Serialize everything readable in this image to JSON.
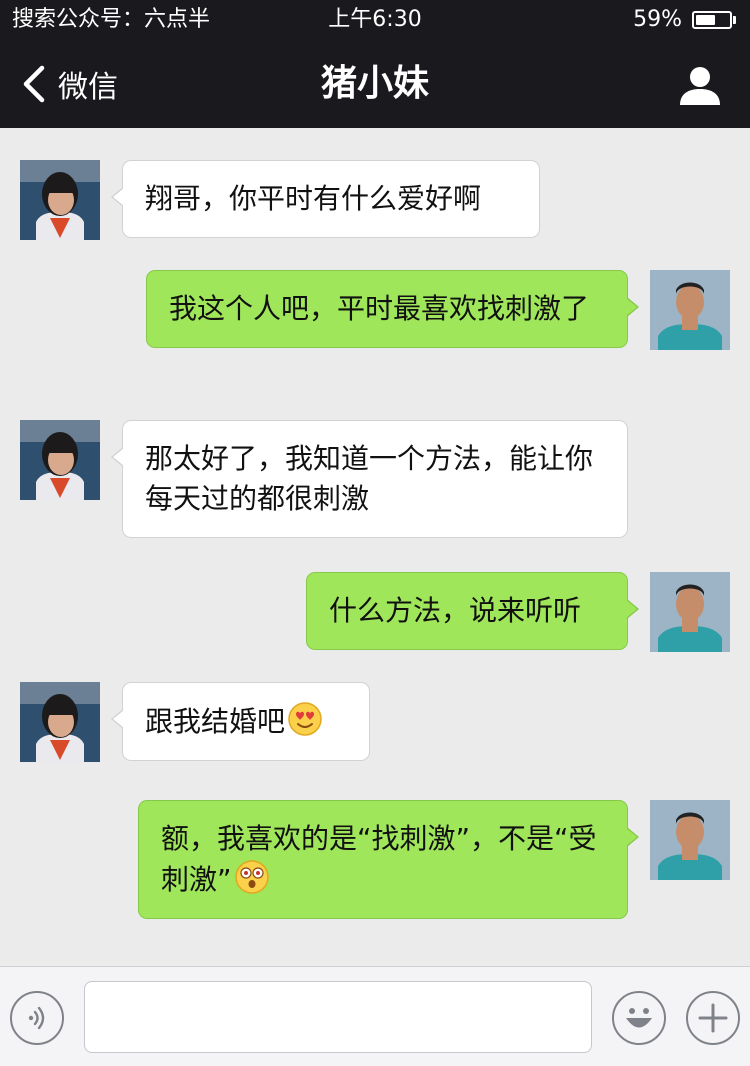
{
  "status_bar": {
    "carrier": "搜索公众号：六点半",
    "time": "上午6:30",
    "battery_percent": "59%",
    "battery_level": 0.59
  },
  "nav": {
    "back_label": "微信",
    "title": "猪小妹",
    "profile_icon": "person-icon"
  },
  "messages": [
    {
      "side": "left",
      "text": "翔哥，你平时有什么爱好啊"
    },
    {
      "side": "right",
      "text": "我这个人吧，平时最喜欢找刺激了"
    },
    {
      "side": "left",
      "text": "那太好了，我知道一个方法，能让你每天过的都很刺激"
    },
    {
      "side": "right",
      "text": "什么方法，说来听听"
    },
    {
      "side": "left",
      "text": "跟我结婚吧",
      "emoji": "heart-eyes-emoji"
    },
    {
      "side": "right",
      "text": "额，我喜欢的是“找刺激”，不是“受刺激”",
      "emoji": "shocked-emoji"
    }
  ],
  "input_bar": {
    "voice_icon": "voice-icon",
    "text_value": "",
    "emoji_icon": "smiley-icon",
    "more_icon": "plus-icon"
  },
  "colors": {
    "nav_background": "#1a191e",
    "chat_background": "#ebebeb",
    "outgoing_bubble": "#9fe65a",
    "incoming_bubble": "#ffffff"
  }
}
